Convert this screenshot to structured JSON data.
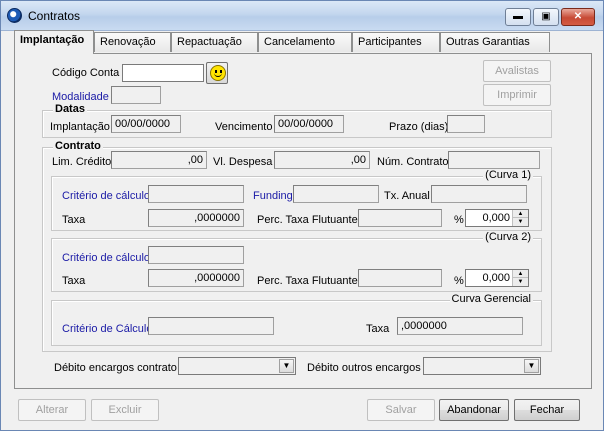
{
  "window": {
    "title": "Contratos",
    "min_glyph": "▬",
    "max_glyph": "▣",
    "close_glyph": "✕"
  },
  "tabs": [
    {
      "label": "Implantação",
      "active": true
    },
    {
      "label": "Renovação"
    },
    {
      "label": "Repactuação"
    },
    {
      "label": "Cancelamento"
    },
    {
      "label": "Participantes"
    },
    {
      "label": "Outras Garantias"
    }
  ],
  "top": {
    "codigo_conta_label": "Código Conta",
    "codigo_conta_value": "",
    "modalidade_label": "Modalidade",
    "modalidade_value": "",
    "avalistas_label": "Avalistas",
    "imprimir_label": "Imprimir",
    "smile_icon": "smiley-face-icon"
  },
  "datas": {
    "title": "Datas",
    "implantacao_label": "Implantação",
    "implantacao_value": "00/00/0000",
    "vencimento_label": "Vencimento",
    "vencimento_value": "00/00/0000",
    "prazo_label": "Prazo (dias)",
    "prazo_value": ""
  },
  "contrato": {
    "title": "Contrato",
    "lim_credito_label": "Lim. Crédito",
    "lim_credito_value": ",00",
    "vl_despesa_label": "Vl. Despesa",
    "vl_despesa_value": ",00",
    "num_contrato_label": "Núm. Contrato",
    "num_contrato_value": ""
  },
  "curva1": {
    "tag": "(Curva 1)",
    "criterio_label": "Critério de cálculo",
    "criterio_value": "",
    "funding_label": "Funding",
    "funding_value": "",
    "tx_anual_label": "Tx. Anual",
    "tx_anual_value": "",
    "taxa_label": "Taxa",
    "taxa_value": ",0000000",
    "perc_label": "Perc. Taxa Flutuante",
    "perc_value": "",
    "pct_symbol": "%",
    "spin_value": "0,000"
  },
  "curva2": {
    "tag": "(Curva 2)",
    "criterio_label": "Critério de cálculo",
    "criterio_value": "",
    "taxa_label": "Taxa",
    "taxa_value": ",0000000",
    "perc_label": "Perc. Taxa Flutuante",
    "perc_value": "",
    "pct_symbol": "%",
    "spin_value": "0,000"
  },
  "gerencial": {
    "tag": "Curva Gerencial",
    "criterio_label": "Critério de Cálculo",
    "criterio_value": "",
    "taxa_label": "Taxa",
    "taxa_value": ",0000000"
  },
  "debitos": {
    "contrato_label": "Débito encargos contrato",
    "contrato_value": "",
    "outros_label": "Débito outros encargos",
    "outros_value": ""
  },
  "footer": {
    "alterar": "Alterar",
    "excluir": "Excluir",
    "salvar": "Salvar",
    "abandonar": "Abandonar",
    "fechar": "Fechar"
  },
  "colors": {
    "label_blue": "#1a1aa6",
    "title_bar": "#c3d6ee",
    "close_red": "#c74a35"
  }
}
